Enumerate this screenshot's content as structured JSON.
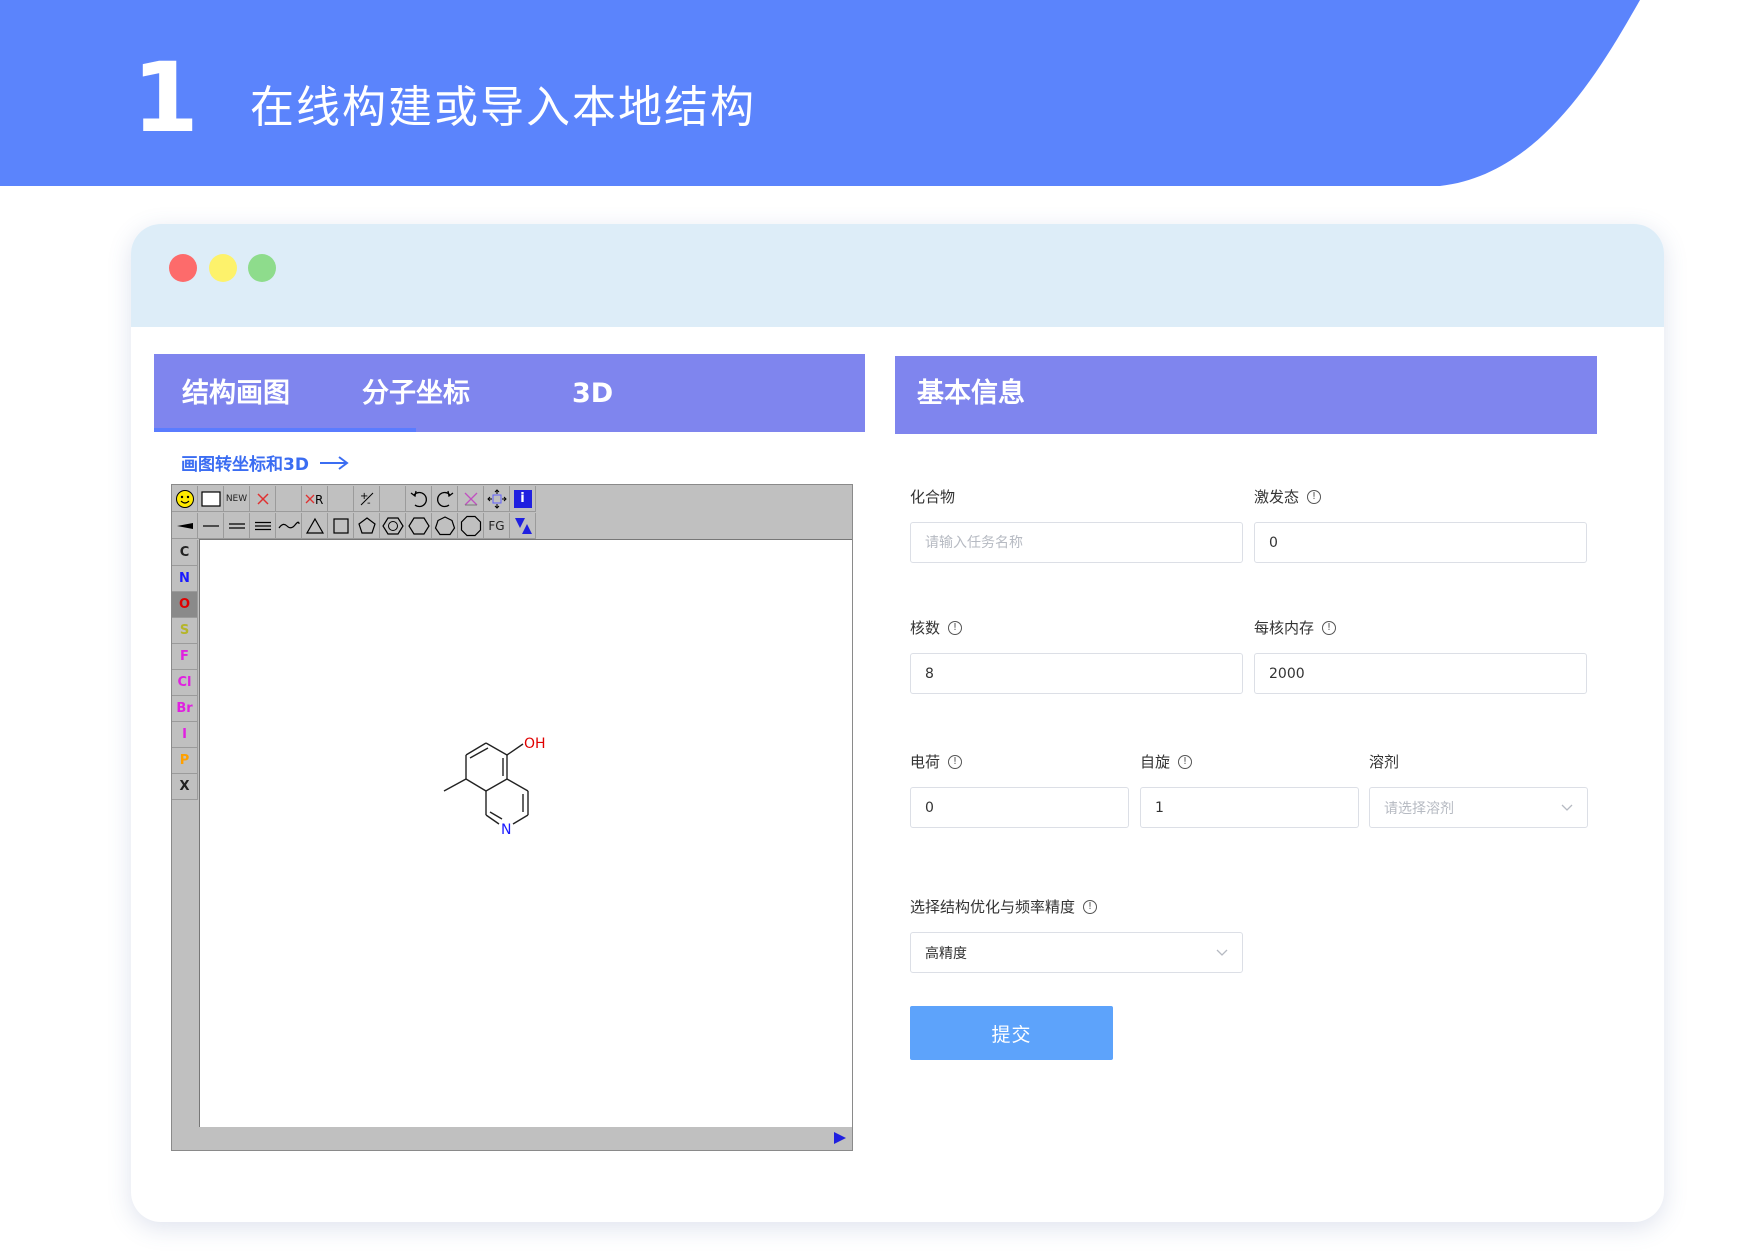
{
  "banner": {
    "step_number": "1",
    "title": "在线构建或导入本地结构",
    "color": "#5b84fc"
  },
  "window": {
    "traffic_lights": [
      "#fd6b6b",
      "#fdf26b",
      "#8edc8c"
    ]
  },
  "left_panel": {
    "tabs": [
      {
        "label": "结构画图",
        "active": true
      },
      {
        "label": "分子坐标",
        "active": false
      },
      {
        "label": "3D",
        "active": false
      }
    ],
    "convert_link": "画图转坐标和3D",
    "editor": {
      "toolbar_row1": [
        "smiley-icon",
        "rectangle-icon",
        "NEW",
        "delete-x-icon",
        "",
        "R-group-icon",
        "",
        "charge-icon",
        "",
        "undo-icon",
        "redo-icon",
        "clear-icon",
        "move-icon",
        "i"
      ],
      "toolbar_row2": [
        "wedge-bond-icon",
        "single-bond-icon",
        "double-bond-icon",
        "triple-bond-icon",
        "chain-icon",
        "triangle-icon",
        "square-icon",
        "pentagon-icon",
        "benzene-icon",
        "hexagon-icon",
        "heptagon-icon",
        "octagon-icon",
        "FG",
        "flip-icon"
      ],
      "new_label": "NEW",
      "fg_label": "FG",
      "info_label": "i",
      "atoms": [
        {
          "symbol": "C",
          "color": "#222222"
        },
        {
          "symbol": "N",
          "color": "#1a1aff"
        },
        {
          "symbol": "O",
          "color": "#e00000"
        },
        {
          "symbol": "S",
          "color": "#b5b52a"
        },
        {
          "symbol": "F",
          "color": "#e020e0"
        },
        {
          "symbol": "Cl",
          "color": "#e020e0"
        },
        {
          "symbol": "Br",
          "color": "#e020e0"
        },
        {
          "symbol": "I",
          "color": "#e020e0"
        },
        {
          "symbol": "P",
          "color": "#ffa000"
        },
        {
          "symbol": "X",
          "color": "#222222"
        }
      ],
      "molecule_labels": {
        "oh": "OH",
        "n": "N"
      }
    }
  },
  "right_panel": {
    "title": "基本信息",
    "fields": {
      "compound": {
        "label": "化合物",
        "value": "",
        "placeholder": "请输入任务名称"
      },
      "excited_state": {
        "label": "激发态",
        "value": "0"
      },
      "cores": {
        "label": "核数",
        "value": "8"
      },
      "memory_per_core": {
        "label": "每核内存",
        "value": "2000"
      },
      "charge": {
        "label": "电荷",
        "value": "0"
      },
      "spin": {
        "label": "自旋",
        "value": "1"
      },
      "solvent": {
        "label": "溶剂",
        "placeholder": "请选择溶剂"
      },
      "precision": {
        "label": "选择结构优化与频率精度",
        "value": "高精度"
      }
    },
    "info_glyph": "!",
    "submit_label": "提交"
  }
}
